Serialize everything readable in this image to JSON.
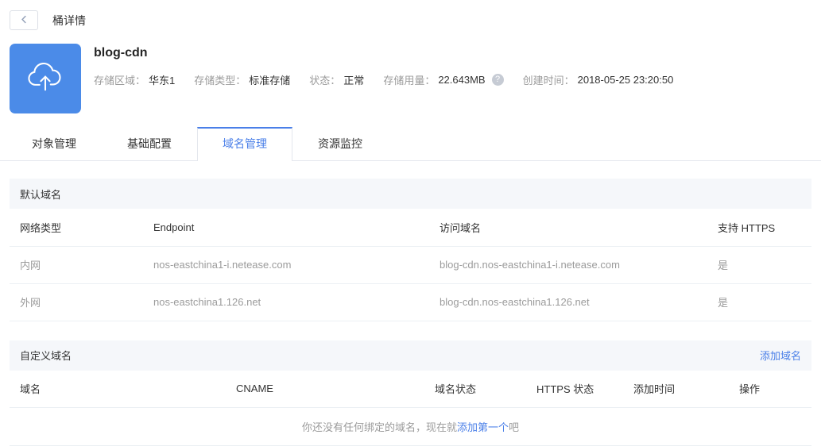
{
  "page": {
    "title": "桶详情"
  },
  "bucket": {
    "name": "blog-cdn",
    "info": {
      "region_label": "存储区域：",
      "region_value": "华东1",
      "type_label": "存储类型：",
      "type_value": "标准存储",
      "status_label": "状态：",
      "status_value": "正常",
      "usage_label": "存储用量：",
      "usage_value": "22.643MB",
      "help_glyph": "?",
      "created_label": "创建时间：",
      "created_value": "2018-05-25 23:20:50"
    }
  },
  "tabs": [
    {
      "label": "对象管理",
      "active": false
    },
    {
      "label": "基础配置",
      "active": false
    },
    {
      "label": "域名管理",
      "active": true
    },
    {
      "label": "资源监控",
      "active": false
    }
  ],
  "default_domain": {
    "title": "默认域名",
    "columns": [
      "网络类型",
      "Endpoint",
      "访问域名",
      "支持 HTTPS"
    ],
    "rows": [
      [
        "内网",
        "nos-eastchina1-i.netease.com",
        "blog-cdn.nos-eastchina1-i.netease.com",
        "是"
      ],
      [
        "外网",
        "nos-eastchina1.126.net",
        "blog-cdn.nos-eastchina1.126.net",
        "是"
      ]
    ]
  },
  "custom_domain": {
    "title": "自定义域名",
    "add_link": "添加域名",
    "columns": [
      "域名",
      "CNAME",
      "域名状态",
      "HTTPS 状态",
      "添加时间",
      "操作"
    ],
    "empty": {
      "prefix": "你还没有任何绑定的域名，现在就",
      "link": "添加第一个",
      "suffix": "吧"
    }
  },
  "icons": {
    "back": "chevron-left-icon",
    "bucket": "cloud-upload-icon",
    "help": "question-circle-icon"
  },
  "colors": {
    "accent_blue": "#4a7fe8",
    "icon_bg_blue": "#4b8be8",
    "section_bg": "#f5f7fa",
    "label_grey": "#9b9b9b",
    "text_dark": "#333333",
    "border": "#ecf0f4"
  }
}
